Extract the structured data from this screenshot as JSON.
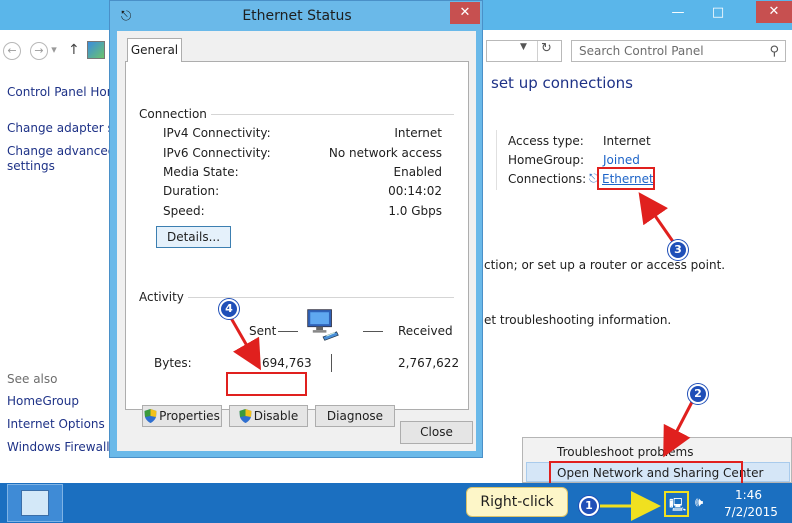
{
  "dialog": {
    "title": "Ethernet Status",
    "tab_general": "General",
    "connection": {
      "heading": "Connection",
      "rows": [
        {
          "label": "IPv4 Connectivity:",
          "value": "Internet"
        },
        {
          "label": "IPv6 Connectivity:",
          "value": "No network access"
        },
        {
          "label": "Media State:",
          "value": "Enabled"
        },
        {
          "label": "Duration:",
          "value": "00:14:02"
        },
        {
          "label": "Speed:",
          "value": "1.0 Gbps"
        }
      ],
      "details_button": "Details..."
    },
    "activity": {
      "heading": "Activity",
      "sent_label": "Sent",
      "received_label": "Received",
      "bytes_label": "Bytes:",
      "bytes_sent": "694,763",
      "bytes_received": "2,767,622"
    },
    "buttons": {
      "properties": "Properties",
      "disable": "Disable",
      "diagnose": "Diagnose",
      "close": "Close"
    }
  },
  "control_panel": {
    "search_placeholder": "Search Control Panel",
    "left_links": [
      "Control Panel Hom",
      "Change adapter set",
      "Change advanced s",
      "settings"
    ],
    "see_also": {
      "heading": "See also",
      "links": [
        "HomeGroup",
        "Internet Options",
        "Windows Firewall"
      ]
    },
    "main_heading": "set up connections",
    "access_type_label": "Access type:",
    "access_type_value": "Internet",
    "homegroup_label": "HomeGroup:",
    "homegroup_value": "Joined",
    "connections_label": "Connections:",
    "connections_value": "Ethernet",
    "text_line_1": "ction; or set up a router or access point.",
    "text_line_2": "et troubleshooting information."
  },
  "context_menu": {
    "items": [
      "Troubleshoot problems",
      "Open Network and Sharing Center"
    ]
  },
  "taskbar": {
    "callout": "Right-click",
    "time": "1:46",
    "date": "7/2/2015"
  },
  "annotations": {
    "step_1": "1",
    "step_2": "2",
    "step_3": "3",
    "step_4": "4"
  },
  "colors": {
    "highlight_red": "#e0201e",
    "annotation_blue": "#1f4fb8",
    "taskbar": "#1b6fc0",
    "titlebar": "#6ab9e9"
  }
}
